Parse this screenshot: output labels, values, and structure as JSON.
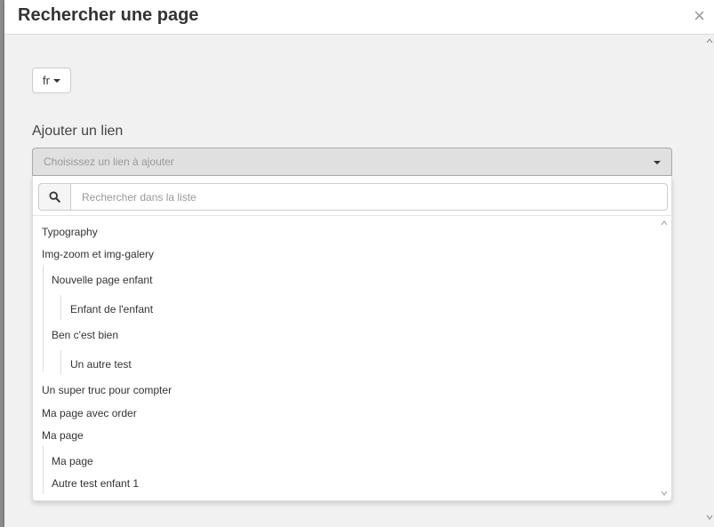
{
  "modal": {
    "title": "Rechercher une page",
    "close_label": "×"
  },
  "language": {
    "selected": "fr"
  },
  "link_section": {
    "label": "Ajouter un lien",
    "select_placeholder": "Choisissez un lien à ajouter"
  },
  "search": {
    "placeholder": "Rechercher dans la liste"
  },
  "pages": [
    {
      "label": "Typography",
      "depth": 0
    },
    {
      "label": "Img-zoom et img-galery",
      "depth": 0
    },
    {
      "label": "Nouvelle page enfant",
      "depth": 1
    },
    {
      "label": "Enfant de l'enfant",
      "depth": 2
    },
    {
      "label": "Ben c'est bien",
      "depth": 1
    },
    {
      "label": "Un autre test",
      "depth": 2
    },
    {
      "label": "Un super truc pour compter",
      "depth": 0
    },
    {
      "label": "Ma page avec order",
      "depth": 0
    },
    {
      "label": "Ma page",
      "depth": 0
    },
    {
      "label": "Ma page",
      "depth": 1
    },
    {
      "label": "Autre test enfant 1",
      "depth": 1
    }
  ],
  "icons": {
    "close": "close-icon",
    "search": "search-icon",
    "caret": "caret-down-icon",
    "scroll_up": "chevron-up-icon",
    "scroll_down": "chevron-down-icon"
  }
}
